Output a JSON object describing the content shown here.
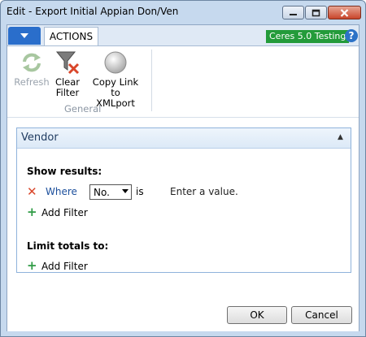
{
  "window": {
    "title": "Edit - Export Initial Appian Don/Ven",
    "minimize_icon": "minimize-icon",
    "maximize_icon": "maximize-icon",
    "close_icon": "close-icon"
  },
  "ribbon": {
    "tab_actions": "ACTIONS",
    "company_badge": "Ceres 5.0 Testing",
    "company_badge_color": "#239b3a",
    "help_symbol": "?",
    "buttons": {
      "refresh": "Refresh",
      "clear_filter_line1": "Clear",
      "clear_filter_line2": "Filter",
      "copy_link_line1": "Copy Link to",
      "copy_link_line2": "XMLport"
    },
    "group_label": "General"
  },
  "fasttab": {
    "title": "Vendor",
    "show_results_label": "Show results:",
    "filter": {
      "where_label": "Where",
      "field_value": "No.",
      "is_label": "is",
      "value_placeholder": "Enter a value."
    },
    "add_filter_label": "Add Filter",
    "limit_totals_label": "Limit totals to:",
    "add_filter_label_2": "Add Filter"
  },
  "footer": {
    "ok_label": "OK",
    "cancel_label": "Cancel"
  }
}
